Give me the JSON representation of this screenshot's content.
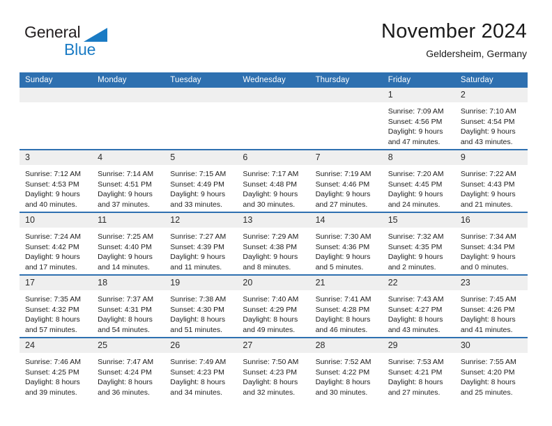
{
  "brand": {
    "word1": "General",
    "word2": "Blue",
    "accent_color": "#1a7bc4"
  },
  "header": {
    "title": "November 2024",
    "location": "Geldersheim, Germany",
    "header_bg_color": "#2E70B0",
    "daynum_bg_color": "#efefef"
  },
  "calendar": {
    "weekday_headers": [
      "Sunday",
      "Monday",
      "Tuesday",
      "Wednesday",
      "Thursday",
      "Friday",
      "Saturday"
    ],
    "weeks": [
      [
        {
          "day": "",
          "lines": [],
          "blank": true
        },
        {
          "day": "",
          "lines": [],
          "blank": true
        },
        {
          "day": "",
          "lines": [],
          "blank": true
        },
        {
          "day": "",
          "lines": [],
          "blank": true
        },
        {
          "day": "",
          "lines": [],
          "blank": true
        },
        {
          "day": "1",
          "lines": [
            "Sunrise: 7:09 AM",
            "Sunset: 4:56 PM",
            "Daylight: 9 hours",
            "and 47 minutes."
          ]
        },
        {
          "day": "2",
          "lines": [
            "Sunrise: 7:10 AM",
            "Sunset: 4:54 PM",
            "Daylight: 9 hours",
            "and 43 minutes."
          ]
        }
      ],
      [
        {
          "day": "3",
          "lines": [
            "Sunrise: 7:12 AM",
            "Sunset: 4:53 PM",
            "Daylight: 9 hours",
            "and 40 minutes."
          ]
        },
        {
          "day": "4",
          "lines": [
            "Sunrise: 7:14 AM",
            "Sunset: 4:51 PM",
            "Daylight: 9 hours",
            "and 37 minutes."
          ]
        },
        {
          "day": "5",
          "lines": [
            "Sunrise: 7:15 AM",
            "Sunset: 4:49 PM",
            "Daylight: 9 hours",
            "and 33 minutes."
          ]
        },
        {
          "day": "6",
          "lines": [
            "Sunrise: 7:17 AM",
            "Sunset: 4:48 PM",
            "Daylight: 9 hours",
            "and 30 minutes."
          ]
        },
        {
          "day": "7",
          "lines": [
            "Sunrise: 7:19 AM",
            "Sunset: 4:46 PM",
            "Daylight: 9 hours",
            "and 27 minutes."
          ]
        },
        {
          "day": "8",
          "lines": [
            "Sunrise: 7:20 AM",
            "Sunset: 4:45 PM",
            "Daylight: 9 hours",
            "and 24 minutes."
          ]
        },
        {
          "day": "9",
          "lines": [
            "Sunrise: 7:22 AM",
            "Sunset: 4:43 PM",
            "Daylight: 9 hours",
            "and 21 minutes."
          ]
        }
      ],
      [
        {
          "day": "10",
          "lines": [
            "Sunrise: 7:24 AM",
            "Sunset: 4:42 PM",
            "Daylight: 9 hours",
            "and 17 minutes."
          ]
        },
        {
          "day": "11",
          "lines": [
            "Sunrise: 7:25 AM",
            "Sunset: 4:40 PM",
            "Daylight: 9 hours",
            "and 14 minutes."
          ]
        },
        {
          "day": "12",
          "lines": [
            "Sunrise: 7:27 AM",
            "Sunset: 4:39 PM",
            "Daylight: 9 hours",
            "and 11 minutes."
          ]
        },
        {
          "day": "13",
          "lines": [
            "Sunrise: 7:29 AM",
            "Sunset: 4:38 PM",
            "Daylight: 9 hours",
            "and 8 minutes."
          ]
        },
        {
          "day": "14",
          "lines": [
            "Sunrise: 7:30 AM",
            "Sunset: 4:36 PM",
            "Daylight: 9 hours",
            "and 5 minutes."
          ]
        },
        {
          "day": "15",
          "lines": [
            "Sunrise: 7:32 AM",
            "Sunset: 4:35 PM",
            "Daylight: 9 hours",
            "and 2 minutes."
          ]
        },
        {
          "day": "16",
          "lines": [
            "Sunrise: 7:34 AM",
            "Sunset: 4:34 PM",
            "Daylight: 9 hours",
            "and 0 minutes."
          ]
        }
      ],
      [
        {
          "day": "17",
          "lines": [
            "Sunrise: 7:35 AM",
            "Sunset: 4:32 PM",
            "Daylight: 8 hours",
            "and 57 minutes."
          ]
        },
        {
          "day": "18",
          "lines": [
            "Sunrise: 7:37 AM",
            "Sunset: 4:31 PM",
            "Daylight: 8 hours",
            "and 54 minutes."
          ]
        },
        {
          "day": "19",
          "lines": [
            "Sunrise: 7:38 AM",
            "Sunset: 4:30 PM",
            "Daylight: 8 hours",
            "and 51 minutes."
          ]
        },
        {
          "day": "20",
          "lines": [
            "Sunrise: 7:40 AM",
            "Sunset: 4:29 PM",
            "Daylight: 8 hours",
            "and 49 minutes."
          ]
        },
        {
          "day": "21",
          "lines": [
            "Sunrise: 7:41 AM",
            "Sunset: 4:28 PM",
            "Daylight: 8 hours",
            "and 46 minutes."
          ]
        },
        {
          "day": "22",
          "lines": [
            "Sunrise: 7:43 AM",
            "Sunset: 4:27 PM",
            "Daylight: 8 hours",
            "and 43 minutes."
          ]
        },
        {
          "day": "23",
          "lines": [
            "Sunrise: 7:45 AM",
            "Sunset: 4:26 PM",
            "Daylight: 8 hours",
            "and 41 minutes."
          ]
        }
      ],
      [
        {
          "day": "24",
          "lines": [
            "Sunrise: 7:46 AM",
            "Sunset: 4:25 PM",
            "Daylight: 8 hours",
            "and 39 minutes."
          ]
        },
        {
          "day": "25",
          "lines": [
            "Sunrise: 7:47 AM",
            "Sunset: 4:24 PM",
            "Daylight: 8 hours",
            "and 36 minutes."
          ]
        },
        {
          "day": "26",
          "lines": [
            "Sunrise: 7:49 AM",
            "Sunset: 4:23 PM",
            "Daylight: 8 hours",
            "and 34 minutes."
          ]
        },
        {
          "day": "27",
          "lines": [
            "Sunrise: 7:50 AM",
            "Sunset: 4:23 PM",
            "Daylight: 8 hours",
            "and 32 minutes."
          ]
        },
        {
          "day": "28",
          "lines": [
            "Sunrise: 7:52 AM",
            "Sunset: 4:22 PM",
            "Daylight: 8 hours",
            "and 30 minutes."
          ]
        },
        {
          "day": "29",
          "lines": [
            "Sunrise: 7:53 AM",
            "Sunset: 4:21 PM",
            "Daylight: 8 hours",
            "and 27 minutes."
          ]
        },
        {
          "day": "30",
          "lines": [
            "Sunrise: 7:55 AM",
            "Sunset: 4:20 PM",
            "Daylight: 8 hours",
            "and 25 minutes."
          ]
        }
      ]
    ]
  }
}
